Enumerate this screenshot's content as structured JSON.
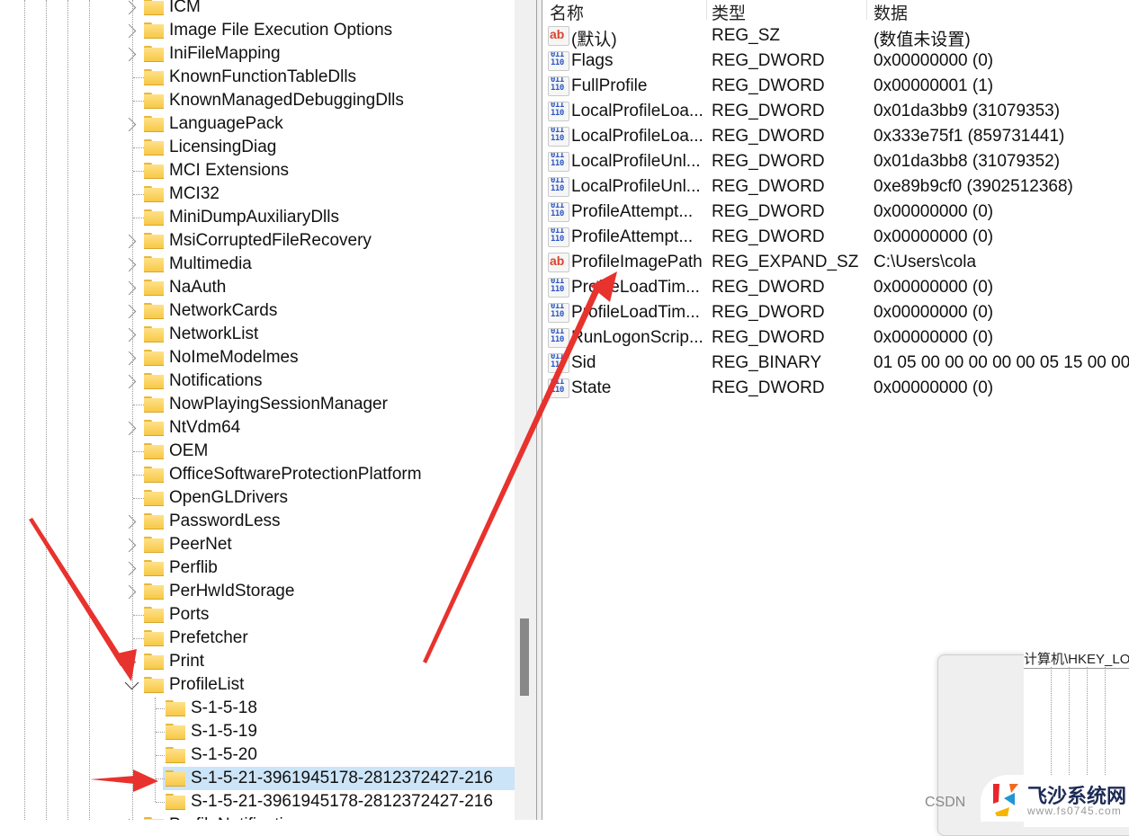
{
  "tree": {
    "items": [
      {
        "label": "ICM",
        "expandable": true
      },
      {
        "label": "Image File Execution Options",
        "expandable": true
      },
      {
        "label": "IniFileMapping",
        "expandable": true
      },
      {
        "label": "KnownFunctionTableDlls",
        "expandable": false
      },
      {
        "label": "KnownManagedDebuggingDlls",
        "expandable": false
      },
      {
        "label": "LanguagePack",
        "expandable": true
      },
      {
        "label": "LicensingDiag",
        "expandable": false
      },
      {
        "label": "MCI Extensions",
        "expandable": false
      },
      {
        "label": "MCI32",
        "expandable": false
      },
      {
        "label": "MiniDumpAuxiliaryDlls",
        "expandable": false
      },
      {
        "label": "MsiCorruptedFileRecovery",
        "expandable": true
      },
      {
        "label": "Multimedia",
        "expandable": true
      },
      {
        "label": "NaAuth",
        "expandable": true
      },
      {
        "label": "NetworkCards",
        "expandable": true
      },
      {
        "label": "NetworkList",
        "expandable": true
      },
      {
        "label": "NoImeModelmes",
        "expandable": true
      },
      {
        "label": "Notifications",
        "expandable": true
      },
      {
        "label": "NowPlayingSessionManager",
        "expandable": false
      },
      {
        "label": "NtVdm64",
        "expandable": true
      },
      {
        "label": "OEM",
        "expandable": false
      },
      {
        "label": "OfficeSoftwareProtectionPlatform",
        "expandable": false
      },
      {
        "label": "OpenGLDrivers",
        "expandable": false
      },
      {
        "label": "PasswordLess",
        "expandable": true
      },
      {
        "label": "PeerNet",
        "expandable": true
      },
      {
        "label": "Perflib",
        "expandable": true
      },
      {
        "label": "PerHwIdStorage",
        "expandable": true
      },
      {
        "label": "Ports",
        "expandable": false
      },
      {
        "label": "Prefetcher",
        "expandable": false
      },
      {
        "label": "Print",
        "expandable": true
      },
      {
        "label": "ProfileList",
        "expandable": true,
        "expanded": true
      }
    ],
    "profile_children": [
      {
        "label": "S-1-5-18",
        "selected": false
      },
      {
        "label": "S-1-5-19",
        "selected": false
      },
      {
        "label": "S-1-5-20",
        "selected": false
      },
      {
        "label": "S-1-5-21-3961945178-2812372427-216",
        "selected": true
      },
      {
        "label": "S-1-5-21-3961945178-2812372427-216",
        "selected": false
      }
    ],
    "partial_next_item": "ProfileNotification"
  },
  "values": {
    "columns": {
      "name": "名称",
      "type": "类型",
      "data": "数据"
    },
    "rows": [
      {
        "icon": "string-value-icon",
        "name": "(默认)",
        "type": "REG_SZ",
        "data": "(数值未设置)"
      },
      {
        "icon": "binary-value-icon",
        "name": "Flags",
        "type": "REG_DWORD",
        "data": "0x00000000 (0)"
      },
      {
        "icon": "binary-value-icon",
        "name": "FullProfile",
        "type": "REG_DWORD",
        "data": "0x00000001 (1)"
      },
      {
        "icon": "binary-value-icon",
        "name": "LocalProfileLoa...",
        "type": "REG_DWORD",
        "data": "0x01da3bb9 (31079353)"
      },
      {
        "icon": "binary-value-icon",
        "name": "LocalProfileLoa...",
        "type": "REG_DWORD",
        "data": "0x333e75f1 (859731441)"
      },
      {
        "icon": "binary-value-icon",
        "name": "LocalProfileUnl...",
        "type": "REG_DWORD",
        "data": "0x01da3bb8 (31079352)"
      },
      {
        "icon": "binary-value-icon",
        "name": "LocalProfileUnl...",
        "type": "REG_DWORD",
        "data": "0xe89b9cf0 (3902512368)"
      },
      {
        "icon": "binary-value-icon",
        "name": "ProfileAttempt...",
        "type": "REG_DWORD",
        "data": "0x00000000 (0)"
      },
      {
        "icon": "binary-value-icon",
        "name": "ProfileAttempt...",
        "type": "REG_DWORD",
        "data": "0x00000000 (0)"
      },
      {
        "icon": "string-value-icon",
        "name": "ProfileImagePath",
        "type": "REG_EXPAND_SZ",
        "data": "C:\\Users\\cola"
      },
      {
        "icon": "binary-value-icon",
        "name": "ProfileLoadTim...",
        "type": "REG_DWORD",
        "data": "0x00000000 (0)"
      },
      {
        "icon": "binary-value-icon",
        "name": "ProfileLoadTim...",
        "type": "REG_DWORD",
        "data": "0x00000000 (0)"
      },
      {
        "icon": "binary-value-icon",
        "name": "RunLogonScrip...",
        "type": "REG_DWORD",
        "data": "0x00000000 (0)"
      },
      {
        "icon": "binary-value-icon",
        "name": "Sid",
        "type": "REG_BINARY",
        "data": "01 05 00 00 00 00 00 05 15 00 00"
      },
      {
        "icon": "binary-value-icon",
        "name": "State",
        "type": "REG_DWORD",
        "data": "0x00000000 (0)"
      }
    ],
    "icon_glyphs": {
      "string": "ab",
      "binary": "011 110"
    }
  },
  "overlay": {
    "title_fragment": "计算机\\HKEY_LOC"
  },
  "watermarks": {
    "csdn": "CSDN",
    "brand_name": "飞沙系统网",
    "brand_url": "www.fs0745.com"
  },
  "colors": {
    "selection": "#cce4f7",
    "annotation_arrow": "#e8322d",
    "folder": "#f7c947",
    "string_icon": "#d9452e",
    "binary_icon": "#2a56c6"
  }
}
